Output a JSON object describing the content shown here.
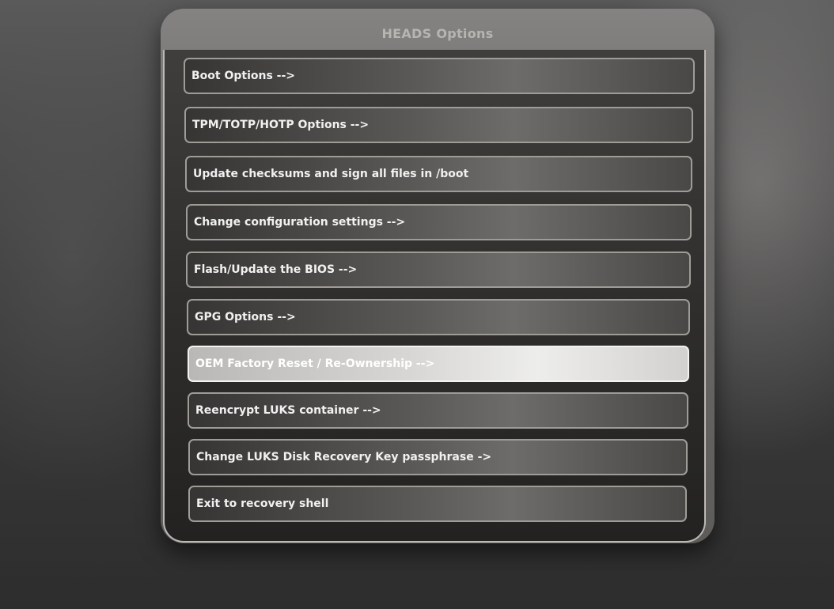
{
  "dialog": {
    "title": "HEADS Options"
  },
  "menu": {
    "items": [
      {
        "label": "Boot Options -->",
        "selected": false
      },
      {
        "label": "TPM/TOTP/HOTP Options -->",
        "selected": false
      },
      {
        "label": "Update checksums and sign all files in /boot",
        "selected": false
      },
      {
        "label": "Change configuration settings -->",
        "selected": false
      },
      {
        "label": "Flash/Update the BIOS -->",
        "selected": false
      },
      {
        "label": "GPG Options -->",
        "selected": false
      },
      {
        "label": "OEM Factory Reset / Re-Ownership -->",
        "selected": true
      },
      {
        "label": "Reencrypt LUKS container -->",
        "selected": false
      },
      {
        "label": "Change LUKS Disk Recovery Key passphrase ->",
        "selected": false
      },
      {
        "label": "Exit to recovery shell",
        "selected": false
      }
    ]
  }
}
